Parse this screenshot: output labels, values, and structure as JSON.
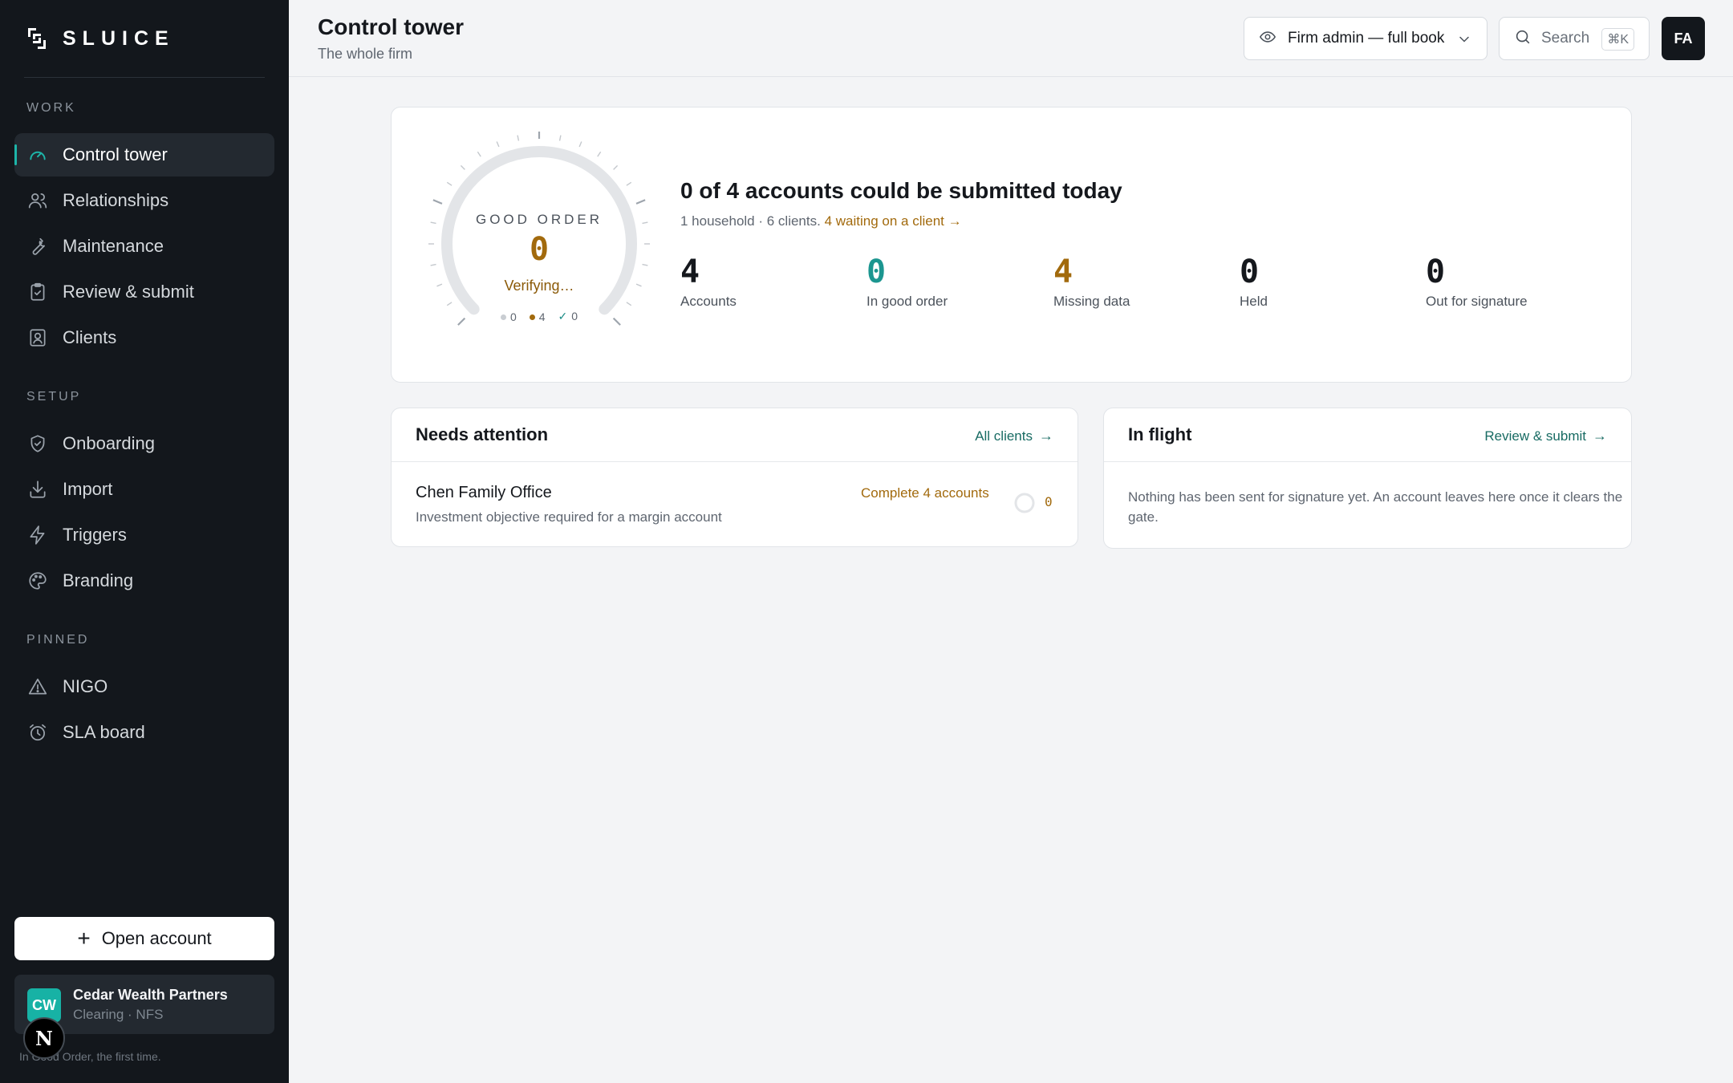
{
  "app": {
    "brand": "SLUICE",
    "tagline": "In Good Order, the first time."
  },
  "sidebar": {
    "sections": {
      "work": "WORK",
      "setup": "SETUP",
      "pinned": "PINNED"
    },
    "items": {
      "control_tower": "Control tower",
      "relationships": "Relationships",
      "maintenance": "Maintenance",
      "review_submit": "Review & submit",
      "clients": "Clients",
      "onboarding": "Onboarding",
      "import": "Import",
      "triggers": "Triggers",
      "branding": "Branding",
      "nigo": "NIGO",
      "sla_board": "SLA board"
    },
    "active": "control_tower",
    "open_account": "Open account",
    "firm": {
      "initials": "CW",
      "name": "Cedar Wealth Partners",
      "sub": "Clearing · NFS"
    },
    "badge": "N"
  },
  "header": {
    "title": "Control tower",
    "subtitle": "The whole firm",
    "view_select": "Firm admin — full book",
    "search_label": "Search",
    "search_shortcut": "⌘K",
    "user_initials": "FA"
  },
  "summary": {
    "gauge": {
      "label": "GOOD ORDER",
      "value": "0",
      "status": "Verifying…",
      "legend": {
        "neutral": "0",
        "missing": "4",
        "good": "0"
      },
      "progress": 0
    },
    "headline": "0 of 4 accounts could be submitted today",
    "sub_text": "1 household · 6 clients.",
    "sub_link": "4 waiting on a client →",
    "stats": [
      {
        "value": "4",
        "label": "Accounts",
        "color": "#15181d"
      },
      {
        "value": "0",
        "label": "In good order",
        "color": "#1c9690"
      },
      {
        "value": "4",
        "label": "Missing data",
        "color": "#a26a0d"
      },
      {
        "value": "0",
        "label": "Held",
        "color": "#15181d"
      },
      {
        "value": "0",
        "label": "Out for signature",
        "color": "#15181d"
      }
    ]
  },
  "needs_attention": {
    "title": "Needs attention",
    "link": "All clients",
    "rows": [
      {
        "name": "Chen Family Office",
        "detail": "Investment objective required for a margin account",
        "action": "Complete 4 accounts",
        "count": "0"
      }
    ]
  },
  "in_flight": {
    "title": "In flight",
    "link": "Review & submit",
    "empty": "Nothing has been sent for signature yet. An account leaves here once it clears the gate."
  },
  "colors": {
    "accent_teal": "#1db5a9",
    "amber": "#a26a0d",
    "sidebar_bg": "#13171c"
  }
}
